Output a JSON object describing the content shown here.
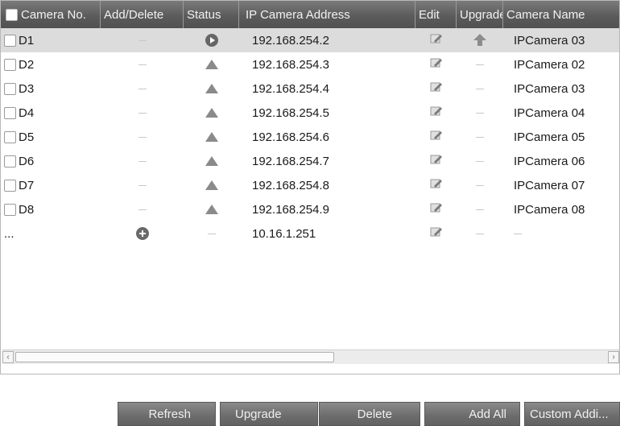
{
  "columns": {
    "camera_no": "Camera No.",
    "add_delete": "Add/Delete",
    "status": "Status",
    "ip_address": "IP Camera Address",
    "edit": "Edit",
    "upgrade": "Upgrade",
    "camera_name": "Camera Name"
  },
  "rows": [
    {
      "no": "D1",
      "ip": "192.168.254.2",
      "name": "IPCamera 03",
      "status_icon": "play-icon",
      "upgrade_icon": "upgrade-arrow-icon"
    },
    {
      "no": "D2",
      "ip": "192.168.254.3",
      "name": "IPCamera 02",
      "status_icon": "warning-icon",
      "upgrade_icon": "dash"
    },
    {
      "no": "D3",
      "ip": "192.168.254.4",
      "name": "IPCamera 03",
      "status_icon": "warning-icon",
      "upgrade_icon": "dash"
    },
    {
      "no": "D4",
      "ip": "192.168.254.5",
      "name": "IPCamera 04",
      "status_icon": "warning-icon",
      "upgrade_icon": "dash"
    },
    {
      "no": "D5",
      "ip": "192.168.254.6",
      "name": "IPCamera 05",
      "status_icon": "warning-icon",
      "upgrade_icon": "dash"
    },
    {
      "no": "D6",
      "ip": "192.168.254.7",
      "name": "IPCamera 06",
      "status_icon": "warning-icon",
      "upgrade_icon": "dash"
    },
    {
      "no": "D7",
      "ip": "192.168.254.8",
      "name": "IPCamera 07",
      "status_icon": "warning-icon",
      "upgrade_icon": "dash"
    },
    {
      "no": "D8",
      "ip": "192.168.254.9",
      "name": "IPCamera 08",
      "status_icon": "warning-icon",
      "upgrade_icon": "dash"
    }
  ],
  "search_row": {
    "no": "...",
    "ip": "10.16.1.251"
  },
  "buttons": {
    "refresh": "Refresh",
    "upgrade": "Upgrade",
    "delete": "Delete",
    "add_all": "Add All",
    "custom_add": "Custom Addi..."
  },
  "colors": {
    "header_bg": "#5c5c5c",
    "selected_row": "#dcdcdc",
    "button_bg": "#6c6c6c"
  }
}
